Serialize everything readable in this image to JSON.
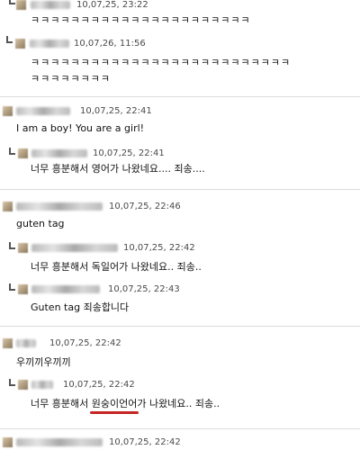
{
  "comments": [
    {
      "timestamp": "10,07,25, 23:22",
      "text": "ㅋㅋㅋㅋㅋㅋㅋㅋㅋㅋㅋㅋㅋㅋㅋㅋㅋㅋㅋㅋㅋㅋ"
    },
    {
      "timestamp": "10,07,26, 11:56",
      "text_line1": "ㅋㅋㅋㅋㅋㅋㅋㅋㅋㅋㅋㅋㅋㅋㅋㅋㅋㅋㅋㅋㅋㅋㅋㅋㅋㅋ",
      "text_line2": "ㅋㅋㅋㅋㅋㅋㅋㅋ"
    },
    {
      "timestamp": "10,07,25, 22:41",
      "text": "I am a boy! You are a girl!"
    },
    {
      "timestamp": "10,07,25, 22:41",
      "text": "너무 흥분해서 영어가 나왔네요.... 죄송...."
    },
    {
      "timestamp": "10,07,25, 22:46",
      "text": "guten tag"
    },
    {
      "timestamp": "10,07,25, 22:42",
      "text": "너무 흥분해서 독일어가 나왔네요.. 죄송.."
    },
    {
      "timestamp": "10,07,25, 22:43",
      "text": "Guten tag 죄송합니다"
    },
    {
      "timestamp": "10,07,25, 22:42",
      "text": "우끼끼우끼끼"
    },
    {
      "timestamp": "10,07,25, 22:42",
      "text_before": "너무 흥분해서 ",
      "text_highlight": "원숭이언어",
      "text_after": "가 나왔네요.. 죄송.."
    },
    {
      "timestamp": "10,07,25, 22:42"
    }
  ]
}
